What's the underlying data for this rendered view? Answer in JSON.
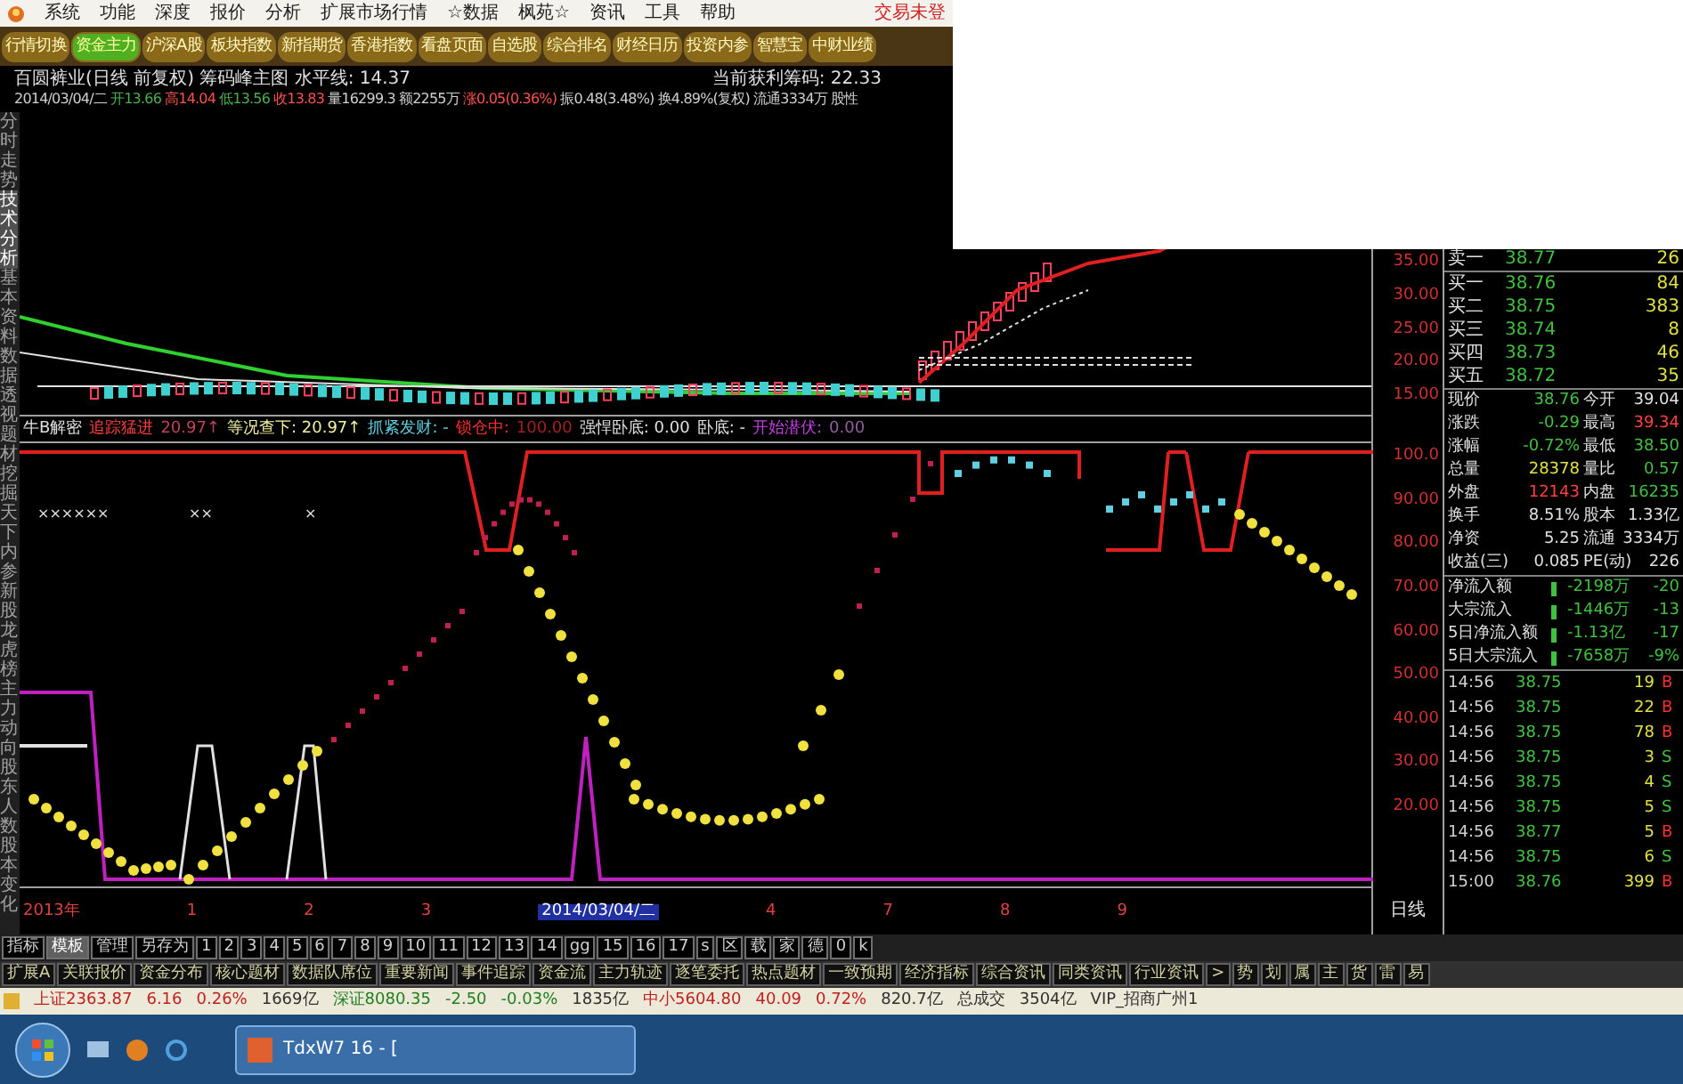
{
  "menu": {
    "items": [
      "系统",
      "功能",
      "深度",
      "报价",
      "分析",
      "扩展市场行情",
      "☆数据",
      "枫苑☆",
      "资讯",
      "工具",
      "帮助"
    ],
    "trade_status": "交易未登"
  },
  "toolbar": [
    {
      "label": "行情切换",
      "selected": false
    },
    {
      "label": "资金主力",
      "selected": true
    },
    {
      "label": "沪深A股",
      "selected": false
    },
    {
      "label": "板块指数",
      "selected": false
    },
    {
      "label": "新指期货",
      "selected": false
    },
    {
      "label": "香港指数",
      "selected": false
    },
    {
      "label": "看盘页面",
      "selected": false
    },
    {
      "label": "自选股",
      "selected": false
    },
    {
      "label": "综合排名",
      "selected": false
    },
    {
      "label": "财经日历",
      "selected": false
    },
    {
      "label": "投资内参",
      "selected": false
    },
    {
      "label": "智慧宝",
      "selected": false
    },
    {
      "label": "中财业绩",
      "selected": false
    }
  ],
  "info": {
    "title": "百圆裤业(日线 前复权) 筹码峰主图 水平线: 14.37",
    "profit_chips": "当前获利筹码: 22.33",
    "bar": [
      {
        "text": "2014/03/04/二",
        "color": "#d0d0d0"
      },
      {
        "text": "开13.66",
        "color": "#4caf50"
      },
      {
        "text": "高14.04",
        "color": "#ff5050"
      },
      {
        "text": "低13.56",
        "color": "#4caf50"
      },
      {
        "text": "收13.83",
        "color": "#ff5050"
      },
      {
        "text": "量16299.3",
        "color": "#d0d0d0"
      },
      {
        "text": "额2255万",
        "color": "#d0d0d0"
      },
      {
        "text": "涨0.05(0.36%)",
        "color": "#ff5050"
      },
      {
        "text": "振0.48(3.48%)",
        "color": "#d0d0d0"
      },
      {
        "text": "换4.89%(复权)",
        "color": "#d0d0d0"
      },
      {
        "text": "流通3334万",
        "color": "#d0d0d0"
      },
      {
        "text": "股性",
        "color": "#d0d0d0"
      }
    ]
  },
  "side_tabs": [
    {
      "label": "分时走势",
      "selected": false
    },
    {
      "label": "技术分析",
      "selected": true
    },
    {
      "label": "基本资料",
      "selected": false
    },
    {
      "label": "数据透视",
      "selected": false
    },
    {
      "label": "题材挖掘",
      "selected": false
    },
    {
      "label": "天下内参",
      "selected": false
    },
    {
      "label": "新股",
      "selected": false
    },
    {
      "label": "龙虎榜",
      "selected": false
    },
    {
      "label": "主力动向",
      "selected": false
    },
    {
      "label": "股东人数",
      "selected": false
    },
    {
      "label": "股本变化",
      "selected": false
    }
  ],
  "indicator_line": [
    {
      "text": "牛B解密",
      "color": "#e0e0e0"
    },
    {
      "text": "追踪猛进",
      "color": "#ff4040"
    },
    {
      "text": "20.97↑",
      "color": "#c04060"
    },
    {
      "text": "等况查下: 20.97↑",
      "color": "#f0f0a0"
    },
    {
      "text": "抓紧发财: -",
      "color": "#60d0e0"
    },
    {
      "text": "锁仓中:",
      "color": "#ff3030"
    },
    {
      "text": "100.00",
      "color": "#a02020"
    },
    {
      "text": "强悍卧底: 0.00",
      "color": "#e0e0e0"
    },
    {
      "text": "卧底: -",
      "color": "#e0e0e0"
    },
    {
      "text": "开始潜伏:",
      "color": "#c040e0"
    },
    {
      "text": "0.00",
      "color": "#9060a0"
    }
  ],
  "indicator_marks": [
    "××××××",
    "××",
    "×"
  ],
  "price_axis": [
    "35.00",
    "30.00",
    "25.00",
    "20.00",
    "15.00"
  ],
  "indicator_axis": [
    "100.0",
    "90.00",
    "80.00",
    "70.00",
    "60.00",
    "50.00",
    "40.00",
    "30.00",
    "20.00"
  ],
  "x_axis": [
    {
      "label": "2013年",
      "selected": false
    },
    {
      "label": "1",
      "selected": false
    },
    {
      "label": "2",
      "selected": false
    },
    {
      "label": "3",
      "selected": false
    },
    {
      "label": "2014/03/04/二",
      "selected": true
    },
    {
      "label": "4",
      "selected": false
    },
    {
      "label": "7",
      "selected": false
    },
    {
      "label": "8",
      "selected": false
    },
    {
      "label": "9",
      "selected": false
    }
  ],
  "period": "日线",
  "order_book": [
    {
      "label": "卖一",
      "price": "38.77",
      "volume": "26"
    },
    {
      "label": "买一",
      "price": "38.76",
      "volume": "84"
    },
    {
      "label": "买二",
      "price": "38.75",
      "volume": "383"
    },
    {
      "label": "买三",
      "price": "38.74",
      "volume": "8"
    },
    {
      "label": "买四",
      "price": "38.73",
      "volume": "46"
    },
    {
      "label": "买五",
      "price": "38.72",
      "volume": "35"
    }
  ],
  "quote": [
    {
      "cells": [
        {
          "label": "现价",
          "value": "38.76",
          "color": "#40c040"
        },
        {
          "label": "今开",
          "value": "39.04",
          "color": "#e0e0e0"
        }
      ]
    },
    {
      "cells": [
        {
          "label": "涨跌",
          "value": "-0.29",
          "color": "#40c040"
        },
        {
          "label": "最高",
          "value": "39.34",
          "color": "#ff4040"
        }
      ]
    },
    {
      "cells": [
        {
          "label": "涨幅",
          "value": "-0.72%",
          "color": "#40c040"
        },
        {
          "label": "最低",
          "value": "38.50",
          "color": "#40c040"
        }
      ]
    },
    {
      "cells": [
        {
          "label": "总量",
          "value": "28378",
          "color": "#e0e040"
        },
        {
          "label": "量比",
          "value": "0.57",
          "color": "#40c040"
        }
      ]
    },
    {
      "cells": [
        {
          "label": "外盘",
          "value": "12143",
          "color": "#ff4040"
        },
        {
          "label": "内盘",
          "value": "16235",
          "color": "#40c040"
        }
      ]
    },
    {
      "cells": [
        {
          "label": "换手",
          "value": "8.51%",
          "color": "#e0e0e0"
        },
        {
          "label": "股本",
          "value": "1.33亿",
          "color": "#e0e0e0"
        }
      ]
    },
    {
      "cells": [
        {
          "label": "净资",
          "value": "5.25",
          "color": "#e0e0e0"
        },
        {
          "label": "流通",
          "value": "3334万",
          "color": "#e0e0e0"
        }
      ]
    },
    {
      "cells": [
        {
          "label": "收益(三)",
          "value": "0.085",
          "color": "#e0e0e0"
        },
        {
          "label": "PE(动)",
          "value": "226",
          "color": "#e0e0e0"
        }
      ]
    }
  ],
  "flows": [
    {
      "label": "净流入额",
      "value": "-2198万",
      "value2": "-20"
    },
    {
      "label": "大宗流入",
      "value": "-1446万",
      "value2": "-13"
    },
    {
      "label": "5日净流入额",
      "value": "-1.13亿",
      "value2": "-17"
    },
    {
      "label": "5日大宗流入",
      "value": "-7658万",
      "value2": "-9%"
    }
  ],
  "ticks": [
    {
      "time": "14:56",
      "price": "38.75",
      "volume": "19",
      "side": "B",
      "kind": "buy"
    },
    {
      "time": "14:56",
      "price": "38.75",
      "volume": "22",
      "side": "B",
      "kind": "buy"
    },
    {
      "time": "14:56",
      "price": "38.75",
      "volume": "78",
      "side": "B",
      "kind": "buy"
    },
    {
      "time": "14:56",
      "price": "38.75",
      "volume": "3",
      "side": "S",
      "kind": "sell"
    },
    {
      "time": "14:56",
      "price": "38.75",
      "volume": "4",
      "side": "S",
      "kind": "sell"
    },
    {
      "time": "14:56",
      "price": "38.75",
      "volume": "5",
      "side": "S",
      "kind": "sell"
    },
    {
      "time": "14:56",
      "price": "38.77",
      "volume": "5",
      "side": "B",
      "kind": "buy"
    },
    {
      "time": "14:56",
      "price": "38.75",
      "volume": "6",
      "side": "S",
      "kind": "sell"
    },
    {
      "time": "15:00",
      "price": "38.76",
      "volume": "399",
      "side": "B",
      "kind": "buy"
    }
  ],
  "bottom_tabs": [
    {
      "label": "指标",
      "selected": false
    },
    {
      "label": "模板",
      "selected": true
    },
    {
      "label": "管理",
      "selected": false
    },
    {
      "label": "另存为",
      "selected": false
    },
    {
      "label": "1",
      "selected": false
    },
    {
      "label": "2",
      "selected": false
    },
    {
      "label": "3",
      "selected": false
    },
    {
      "label": "4",
      "selected": false
    },
    {
      "label": "5",
      "selected": false
    },
    {
      "label": "6",
      "selected": false
    },
    {
      "label": "7",
      "selected": false
    },
    {
      "label": "8",
      "selected": false
    },
    {
      "label": "9",
      "selected": false
    },
    {
      "label": "10",
      "selected": false
    },
    {
      "label": "11",
      "selected": false
    },
    {
      "label": "12",
      "selected": false
    },
    {
      "label": "13",
      "selected": false
    },
    {
      "label": "14",
      "selected": false
    },
    {
      "label": "gg",
      "selected": false
    },
    {
      "label": "15",
      "selected": false
    },
    {
      "label": "16",
      "selected": false
    },
    {
      "label": "17",
      "selected": false
    },
    {
      "label": "s",
      "selected": false
    },
    {
      "label": "区",
      "selected": false
    },
    {
      "label": "载",
      "selected": false
    },
    {
      "label": "家",
      "selected": false
    },
    {
      "label": "德",
      "selected": false
    },
    {
      "label": "0",
      "selected": false
    },
    {
      "label": "k",
      "selected": false
    }
  ],
  "function_tabs": [
    "扩展A",
    "关联报价",
    "资金分布",
    "核心题材",
    "数据队席位",
    "重要新闻",
    "事件追踪",
    "资金流",
    "主力轨迹",
    "逐笔委托",
    "热点题材",
    "一致预期",
    "经济指标",
    "综合资讯",
    "同类资讯",
    "行业资讯",
    ">",
    "势",
    "划",
    "属",
    "主",
    "货",
    "雷",
    "易"
  ],
  "status_bar": [
    {
      "text": "上证2363.87",
      "color": "#c02020"
    },
    {
      "text": "6.16",
      "color": "#c02020"
    },
    {
      "text": "0.26%",
      "color": "#c02020"
    },
    {
      "text": "1669亿",
      "color": "#303030"
    },
    {
      "text": "深证8080.35",
      "color": "#208020"
    },
    {
      "text": "-2.50",
      "color": "#208020"
    },
    {
      "text": "-0.03%",
      "color": "#208020"
    },
    {
      "text": "1835亿",
      "color": "#303030"
    },
    {
      "text": "中小5604.80",
      "color": "#c02020"
    },
    {
      "text": "40.09",
      "color": "#c02020"
    },
    {
      "text": "0.72%",
      "color": "#c02020"
    },
    {
      "text": "820.7亿",
      "color": "#303030"
    },
    {
      "text": "总成交",
      "color": "#303030"
    },
    {
      "text": "3504亿",
      "color": "#303030"
    },
    {
      "text": "VIP_招商广州1",
      "color": "#303030"
    }
  ],
  "taskbar": {
    "task": "TdxW7 16 - ["
  }
}
